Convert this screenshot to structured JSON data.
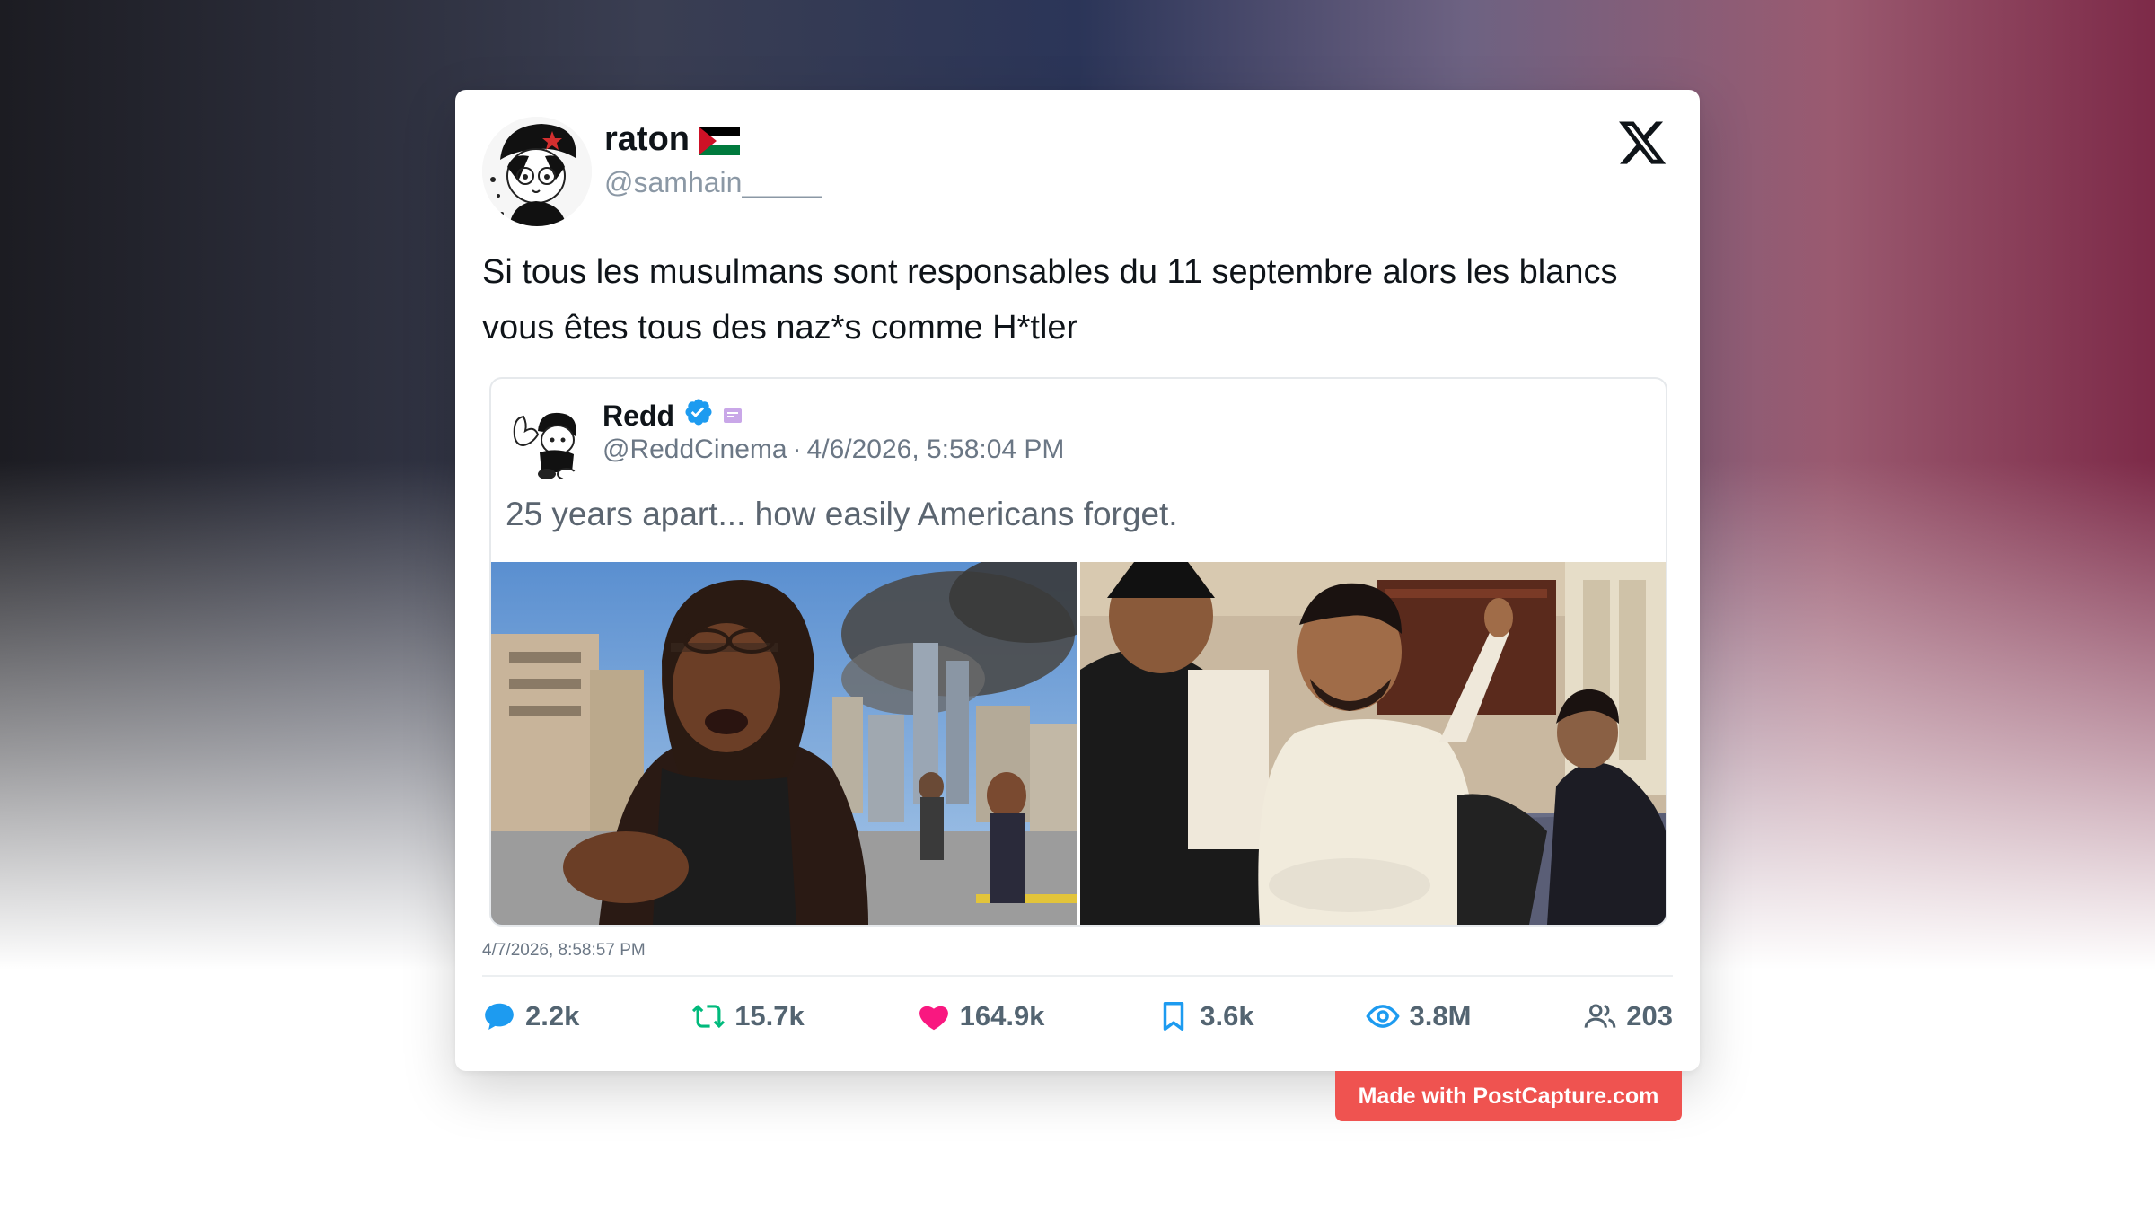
{
  "post": {
    "author": {
      "display_name": "raton",
      "flag": "palestine-flag",
      "handle": "@samhain_____"
    },
    "text_line1": "Si tous les musulmans sont responsables du 11 septembre alors les blancs",
    "text_line2": "vous êtes tous des naz*s comme H*tler",
    "timestamp": "4/7/2026, 8:58:57 PM"
  },
  "quote": {
    "author": {
      "display_name": "Redd",
      "verified": true,
      "handle": "@ReddCinema",
      "separator": "·",
      "date": "4/6/2026, 5:58:04 PM"
    },
    "text": "25 years apart... how easily Americans forget."
  },
  "stats": {
    "replies": "2.2k",
    "retweets": "15.7k",
    "likes": "164.9k",
    "bookmarks": "3.6k",
    "views": "3.8M",
    "followers": "203"
  },
  "watermark": "Made with PostCapture.com",
  "colors": {
    "reply": "#1d9bf0",
    "retweet": "#00ba7c",
    "like": "#f91880",
    "bookmark": "#1d9bf0",
    "views": "#1d9bf0",
    "people": "#536471",
    "watermark_bg": "#ef5350"
  }
}
